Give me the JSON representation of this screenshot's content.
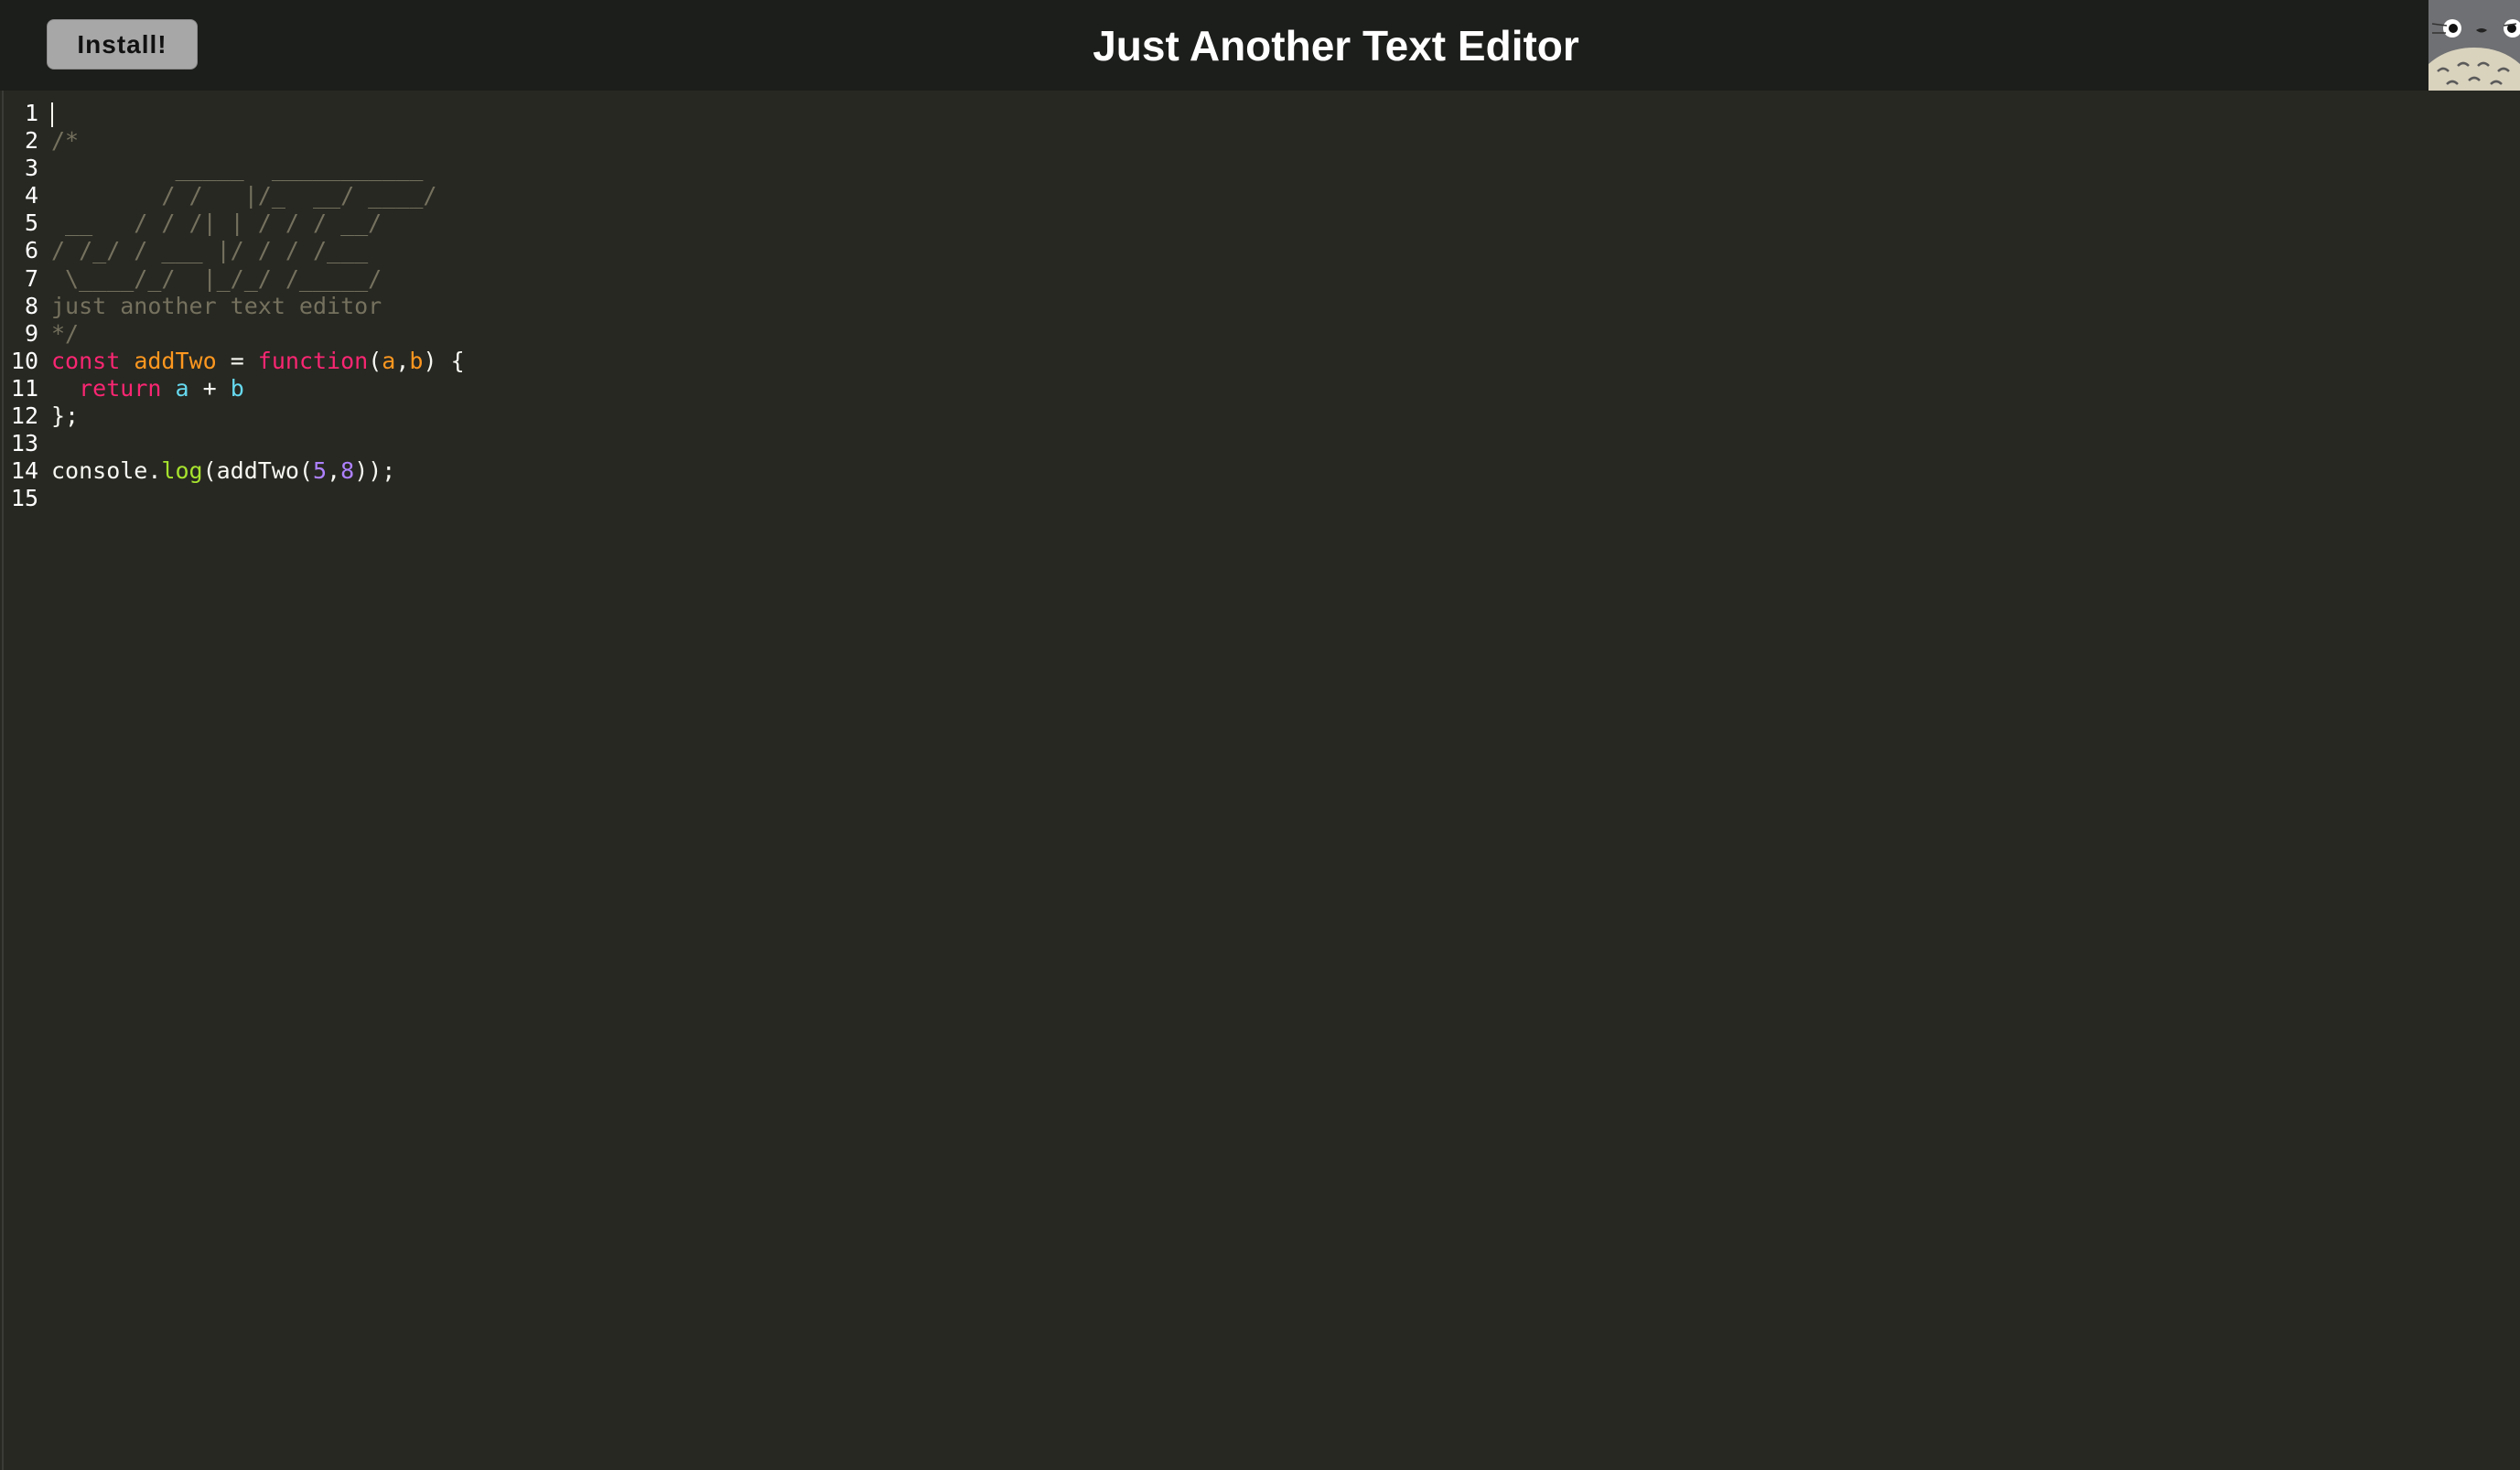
{
  "header": {
    "install_label": "Install!",
    "title": "Just Another Text Editor",
    "logo_icon": "totoro-logo-icon"
  },
  "editor": {
    "lines": [
      {
        "n": "1",
        "t": ""
      },
      {
        "n": "2",
        "t": "/*"
      },
      {
        "n": "3",
        "t": "         _____  ___________"
      },
      {
        "n": "4",
        "t": "        / /   |/_  __/ ____/"
      },
      {
        "n": "5",
        "t": " __   / / /| | / / / __/"
      },
      {
        "n": "6",
        "t": "/ /_/ / ___ |/ / / /___"
      },
      {
        "n": "7",
        "t": " \\____/_/  |_/_/ /_____/"
      },
      {
        "n": "8",
        "t": "just another text editor"
      },
      {
        "n": "9",
        "t": "*/"
      },
      {
        "n": "10",
        "t": "const addTwo = function(a,b) {"
      },
      {
        "n": "11",
        "t": "  return a + b"
      },
      {
        "n": "12",
        "t": "};"
      },
      {
        "n": "13",
        "t": ""
      },
      {
        "n": "14",
        "t": "console.log(addTwo(5,8));"
      },
      {
        "n": "15",
        "t": ""
      }
    ],
    "tokens": {
      "l10_const": "const",
      "l10_name": "addTwo",
      "l10_eq": " = ",
      "l10_function": "function",
      "l10_open": "(",
      "l10_a": "a",
      "l10_comma": ",",
      "l10_b": "b",
      "l10_close": ") {",
      "l11_indent": "  ",
      "l11_return": "return",
      "l11_sp": " ",
      "l11_a": "a",
      "l11_plus": " + ",
      "l11_b": "b",
      "l12": "};",
      "l14_console": "console.",
      "l14_log": "log",
      "l14_call": "(addTwo(",
      "l14_5": "5",
      "l14_comma": ",",
      "l14_8": "8",
      "l14_end": "));"
    }
  },
  "colors": {
    "background": "#272822",
    "header": "#1c1e1b",
    "comment": "#75715e",
    "keyword": "#f92672",
    "function_name": "#fd971f",
    "variable": "#66d9ef",
    "number": "#ae81ff",
    "property": "#a6e22e"
  }
}
